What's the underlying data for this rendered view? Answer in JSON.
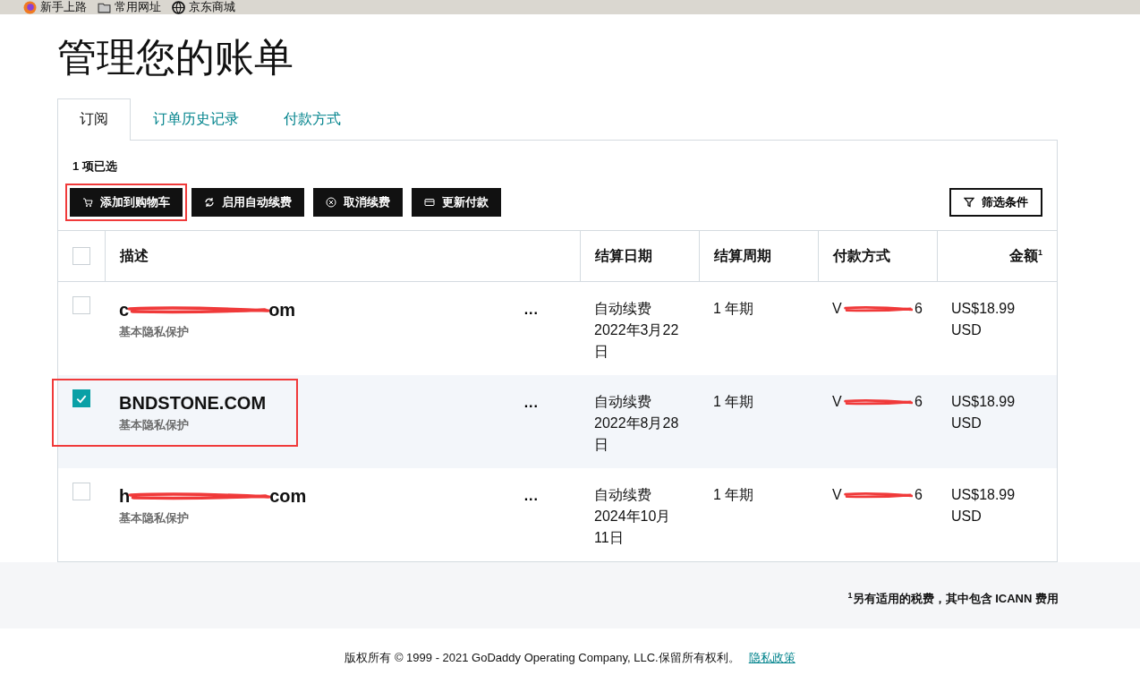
{
  "bookmarks": [
    {
      "label": "新手上路",
      "kind": "firefox"
    },
    {
      "label": "常用网址",
      "kind": "folder"
    },
    {
      "label": "京东商城",
      "kind": "globe"
    }
  ],
  "title": "管理您的账单",
  "tabs": [
    {
      "label": "订阅",
      "selected": true
    },
    {
      "label": "订单历史记录",
      "selected": false
    },
    {
      "label": "付款方式",
      "selected": false
    }
  ],
  "selection_count": "1 项已选",
  "actions": [
    {
      "label": "添加到购物车",
      "kind": "cart",
      "highlighted": true
    },
    {
      "label": "启用自动续费",
      "kind": "refresh",
      "highlighted": false
    },
    {
      "label": "取消续费",
      "kind": "cancel",
      "highlighted": false
    },
    {
      "label": "更新付款",
      "kind": "card",
      "highlighted": false
    }
  ],
  "filter_button": "筛选条件",
  "table": {
    "select_all": {
      "checked": false
    },
    "columns": [
      "描述",
      "结算日期",
      "结算周期",
      "付款方式",
      "金额$^{1}$"
    ],
    "rows": [
      {
        "selected": false,
        "highlighted": false,
        "domain": [
          "c",
          "om"
        ],
        "redacted_domain": true,
        "subtitle": "基本隐私保护",
        "menu": "...",
        "date": "自动续费 2022年3月22日",
        "period": "1 年期",
        "payment": [
          "V",
          "6"
        ],
        "amount": "US$18.99 USD"
      },
      {
        "selected": true,
        "highlighted": true,
        "domain": [
          "BNDSTONE.COM"
        ],
        "redacted_domain": false,
        "subtitle": "基本隐私保护",
        "menu": "...",
        "date": "自动续费 2022年8月28日",
        "period": "1 年期",
        "payment": [
          "V",
          "6"
        ],
        "amount": "US$18.99 USD"
      },
      {
        "selected": false,
        "highlighted": false,
        "domain": [
          "h",
          "com"
        ],
        "redacted_domain": true,
        "subtitle": "基本隐私保护",
        "menu": "...",
        "date": "自动续费 2024年10月11日",
        "period": "1 年期",
        "payment": [
          "V",
          "6"
        ],
        "amount": "US$18.99 USD"
      }
    ]
  },
  "footnote": "$^{1}$另有适用的税费，其中包含 ICANN 费用",
  "copyright": "版权所有 © 1999 - 2021 GoDaddy Operating Company, LLC.保留所有权利。",
  "privacy_link": "隐私政策"
}
